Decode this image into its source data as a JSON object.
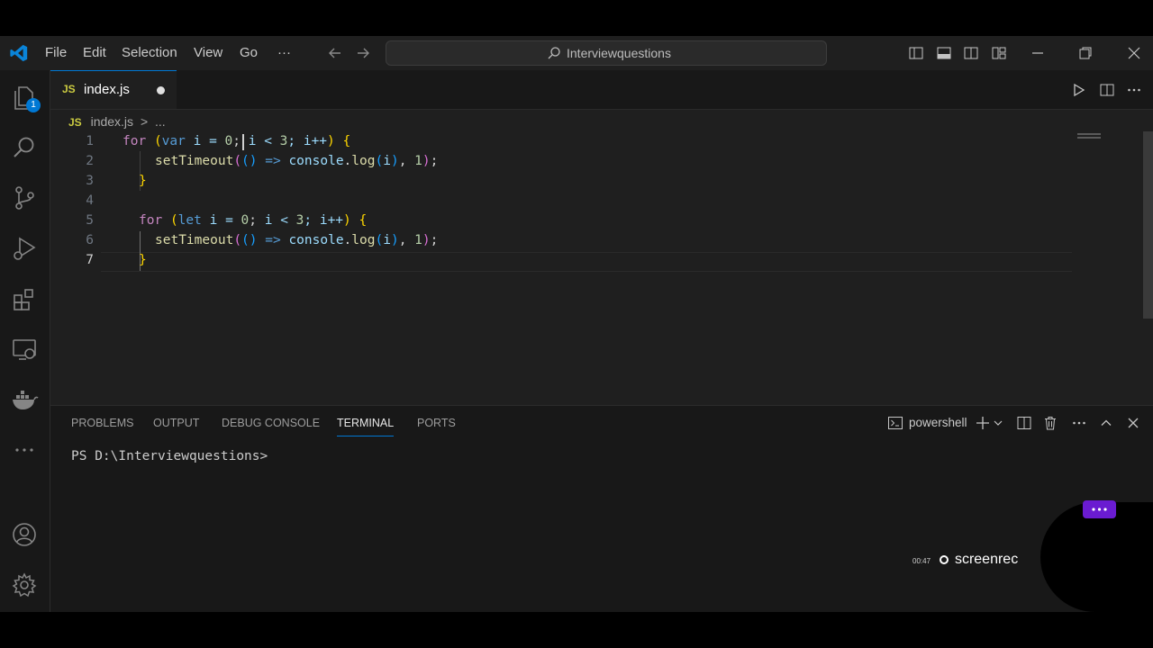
{
  "menu": {
    "file": "File",
    "edit": "Edit",
    "selection": "Selection",
    "view": "View",
    "go": "Go",
    "more": "···"
  },
  "search": {
    "text": "Interviewquestions"
  },
  "activity": {
    "explorer_badge": "1"
  },
  "tab": {
    "lang": "JS",
    "name": "index.js"
  },
  "breadcrumb": {
    "lang": "JS",
    "file": "index.js",
    "sep": ">",
    "more": "..."
  },
  "code": {
    "line_numbers": [
      "1",
      "2",
      "3",
      "4",
      "5",
      "6",
      "7"
    ],
    "l1": {
      "kw": "for",
      "p_open": "(",
      "decl": "var",
      "body": " i = ",
      "n0": "0",
      "semi": "; ",
      "cond": "i < ",
      "n3": "3",
      "rest": "; i++",
      "p_close": ")",
      "brace": " {"
    },
    "l2": {
      "fn": "setTimeout",
      "p1": "(",
      "p2": "()",
      "arrow": " => ",
      "obj": "console",
      "dot": ".",
      "fn2": "log",
      "p3a": "(",
      "arg": "i",
      "p3b": ")",
      "comma": ", ",
      "n1": "1",
      "p1c": ")",
      "semi": ";"
    },
    "l3": {
      "brace": "}"
    },
    "l5": {
      "kw": "for",
      "p_open": "(",
      "decl": "let",
      "body": " i = ",
      "n0": "0",
      "semi": "; ",
      "cond": "i < ",
      "n3": "3",
      "rest": "; i++",
      "p_close": ")",
      "brace": " {"
    },
    "l6": {
      "fn": "setTimeout",
      "p1": "(",
      "p2": "()",
      "arrow": " => ",
      "obj": "console",
      "dot": ".",
      "fn2": "log",
      "p3a": "(",
      "arg": "i",
      "p3b": ")",
      "comma": ", ",
      "n1": "1",
      "p1c": ")",
      "semi": ";"
    },
    "l7": {
      "brace": "}"
    }
  },
  "panel": {
    "tabs": [
      "PROBLEMS",
      "OUTPUT",
      "DEBUG CONSOLE",
      "TERMINAL",
      "PORTS"
    ],
    "active_tab": "TERMINAL",
    "shell": "powershell",
    "terminal_prompt": "PS D:\\Interviewquestions>"
  },
  "overlay": {
    "timer": "00:47",
    "brand": "screenrec"
  },
  "colors": {
    "accent": "#0078d4",
    "editor_bg": "#1f1f1f",
    "bar_bg": "#181818",
    "record_button": "#6a1bd1"
  }
}
